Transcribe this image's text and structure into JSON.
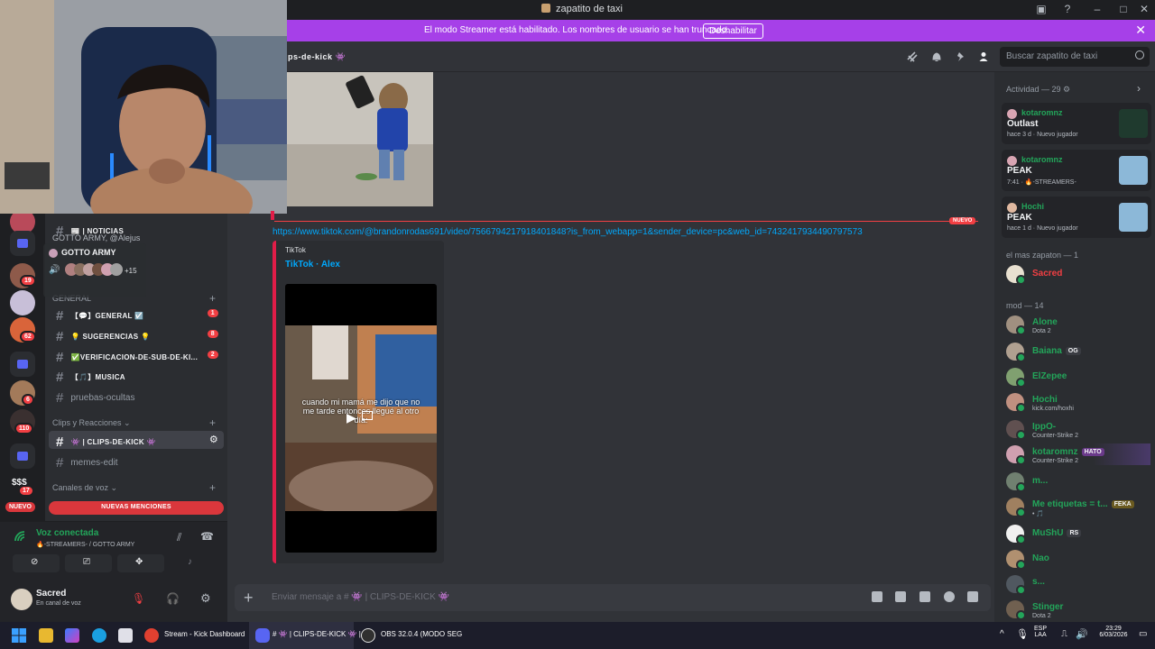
{
  "window": {
    "title": "zapatito de taxi"
  },
  "banner": {
    "message": "El modo Streamer está habilitado. Los nombres de usuario se han truncado.",
    "button": "Deshabilitar"
  },
  "header": {
    "channel": "ips-de-kick 👾",
    "search_placeholder": "Buscar zapatito de taxi"
  },
  "servers": {
    "badges": [
      "19",
      "62",
      "6",
      "110",
      "17"
    ],
    "new_label": "NUEVO",
    "money_label": "$$$"
  },
  "popover": {
    "title": "GOTTO ARMY",
    "overlay_text": "GOTTO ARMY, @Alejus",
    "more": "+15"
  },
  "sidebar": {
    "channels": [
      {
        "name": "📰 | NOTICIAS",
        "count": ""
      },
      {
        "name": "【💬】GENERAL ☑️",
        "count": "1"
      },
      {
        "name": "💡 SUGERENCIAS 💡",
        "count": "8"
      },
      {
        "name": "✅VERIFICACION-DE-SUB-DE-KI...",
        "count": "2"
      },
      {
        "name": "【🎵】MUSICA",
        "count": ""
      },
      {
        "name": "pruebas-ocultas",
        "count": ""
      }
    ],
    "category_general": "GENERAL",
    "category_clips": "Clips y Reacciones",
    "clips_channels": [
      "👾 | CLIPS-DE-KICK 👾",
      "memes-edit"
    ],
    "category_voice": "Canales de voz",
    "mentions": "NUEVAS MENCIONES"
  },
  "voice": {
    "status": "Voz conectada",
    "where": "🔥-STREAMERS- / GOTTO ARMY",
    "user": "Sacred",
    "user_status": "En canal de voz"
  },
  "chat": {
    "new_label": "NUEVO",
    "link": "https://www.tiktok.com/@brandonrodas691/video/7566794217918401848?is_from_webapp=1&sender_device=pc&web_id=7432417934490797573",
    "embed_provider": "TikTok",
    "embed_title": "TikTok · Alex",
    "video_caption": "cuando mi mamá me dijo que no me tarde entonces llegué al otro día:",
    "composer_placeholder": "Enviar mensaje a # 👾 | CLIPS-DE-KICK 👾"
  },
  "members": {
    "activity_header": "Actividad — 29",
    "activities": [
      {
        "user": "kotaromnz",
        "game": "Outlast",
        "meta": "hace 3 d · Nuevo jugador",
        "art_color": "#1f3a2e"
      },
      {
        "user": "kotaromnz",
        "game": "PEAK",
        "meta": "7:41 · 🔥-STREAMERS-",
        "art_color": "#8cb8d8"
      },
      {
        "user": "Hochi",
        "game": "PEAK",
        "meta": "hace 1 d · Nuevo jugador",
        "art_color": "#8cb8d8"
      }
    ],
    "group1_header": "el mas zapaton — 1",
    "group1": [
      {
        "name": "Sacred",
        "sub": "",
        "tag": "",
        "color": "#f23f43"
      }
    ],
    "group2_header": "mod — 14",
    "group2": [
      {
        "name": "Alone",
        "sub": "Dota 2",
        "tag": ""
      },
      {
        "name": "Baiana",
        "sub": "",
        "tag": "OG"
      },
      {
        "name": "ElZepee",
        "sub": "",
        "tag": ""
      },
      {
        "name": "Hochi",
        "sub": "kick.com/hoxhi",
        "tag": ""
      },
      {
        "name": "IppO-",
        "sub": "Counter-Strike 2",
        "tag": ""
      },
      {
        "name": "kotaromnz",
        "sub": "Counter-Strike 2",
        "tag": "HATO"
      },
      {
        "name": "m...",
        "sub": "",
        "tag": ""
      },
      {
        "name": "Me etiquetas = t...",
        "sub": "• 🎵",
        "tag": "FEKA"
      },
      {
        "name": "MuShU",
        "sub": "",
        "tag": "RS"
      },
      {
        "name": "Nao",
        "sub": "",
        "tag": ""
      },
      {
        "name": "s...",
        "sub": "",
        "tag": ""
      },
      {
        "name": "Stinger",
        "sub": "Dota 2",
        "tag": ""
      }
    ]
  },
  "taskbar": {
    "apps": [
      "Stream - Kick Dashboard",
      "# 👾 | CLIPS-DE-KICK 👾 |",
      "OBS 32.0.4 (MODO SEG"
    ],
    "lang": "ESP",
    "lang2": "LAA",
    "time": "23:29",
    "date": "6/03/2026"
  }
}
